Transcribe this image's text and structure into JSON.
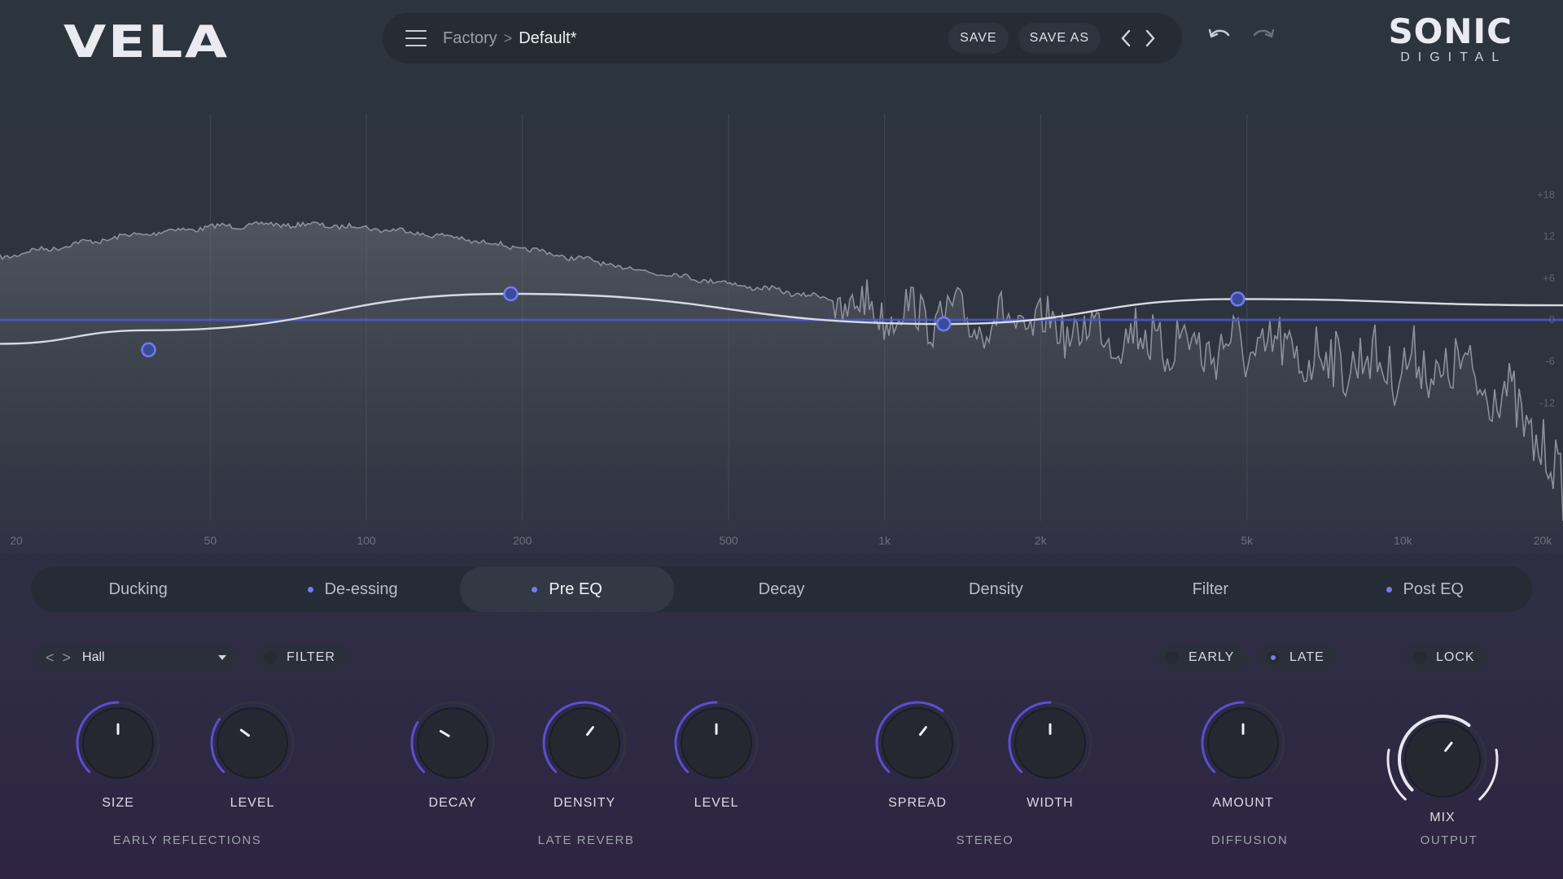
{
  "app": {
    "logo": "VELA",
    "brand": "SONIC",
    "brand_sub": "DIGITAL"
  },
  "topbar": {
    "breadcrumb_parent": "Factory",
    "breadcrumb_sep": ">",
    "preset_name": "Default*",
    "save_label": "SAVE",
    "save_as_label": "SAVE AS"
  },
  "icons": {
    "menu": "menu-icon",
    "prev": "chevron-left-icon",
    "next": "chevron-right-icon",
    "undo": "undo-icon",
    "redo": "redo-icon",
    "dropdown": "chevron-down-icon"
  },
  "eq": {
    "freq_labels": [
      "20",
      "50",
      "100",
      "200",
      "500",
      "1k",
      "2k",
      "5k",
      "10k",
      "20k"
    ],
    "db_labels": [
      "+18",
      "12",
      "+6",
      "0",
      "-6",
      "-12"
    ],
    "nodes": [
      {
        "freq": "38",
        "gain": -1
      },
      {
        "freq": "190",
        "gain": 2.5
      },
      {
        "freq": "1.3k",
        "gain": -0.4
      },
      {
        "freq": "4.8k",
        "gain": 2
      }
    ]
  },
  "tabs": [
    {
      "label": "Ducking",
      "dot": false,
      "active": false
    },
    {
      "label": "De-essing",
      "dot": true,
      "active": false
    },
    {
      "label": "Pre EQ",
      "dot": true,
      "active": true
    },
    {
      "label": "Decay",
      "dot": false,
      "active": false
    },
    {
      "label": "Density",
      "dot": false,
      "active": false
    },
    {
      "label": "Filter",
      "dot": false,
      "active": false
    },
    {
      "label": "Post EQ",
      "dot": true,
      "active": false
    }
  ],
  "controls": {
    "preset_prev": "<",
    "preset_next": ">",
    "algorithm": "Hall",
    "filter_label": "FILTER",
    "early_label": "EARLY",
    "late_label": "LATE",
    "lock_label": "LOCK"
  },
  "knobs": [
    {
      "label": "SIZE",
      "value": 0.5
    },
    {
      "label": "LEVEL",
      "value": 0.3
    },
    {
      "label": "DECAY",
      "value": 0.28
    },
    {
      "label": "DENSITY",
      "value": 0.64
    },
    {
      "label": "LEVEL",
      "value": 0.5
    },
    {
      "label": "SPREAD",
      "value": 0.64
    },
    {
      "label": "WIDTH",
      "value": 0.5
    },
    {
      "label": "AMOUNT",
      "value": 0.5
    },
    {
      "label": "MIX",
      "value": 0.64
    }
  ],
  "groups": {
    "early": "EARLY REFLECTIONS",
    "late": "LATE REVERB",
    "stereo": "STEREO",
    "diffusion": "DIFFUSION",
    "output": "OUTPUT"
  }
}
